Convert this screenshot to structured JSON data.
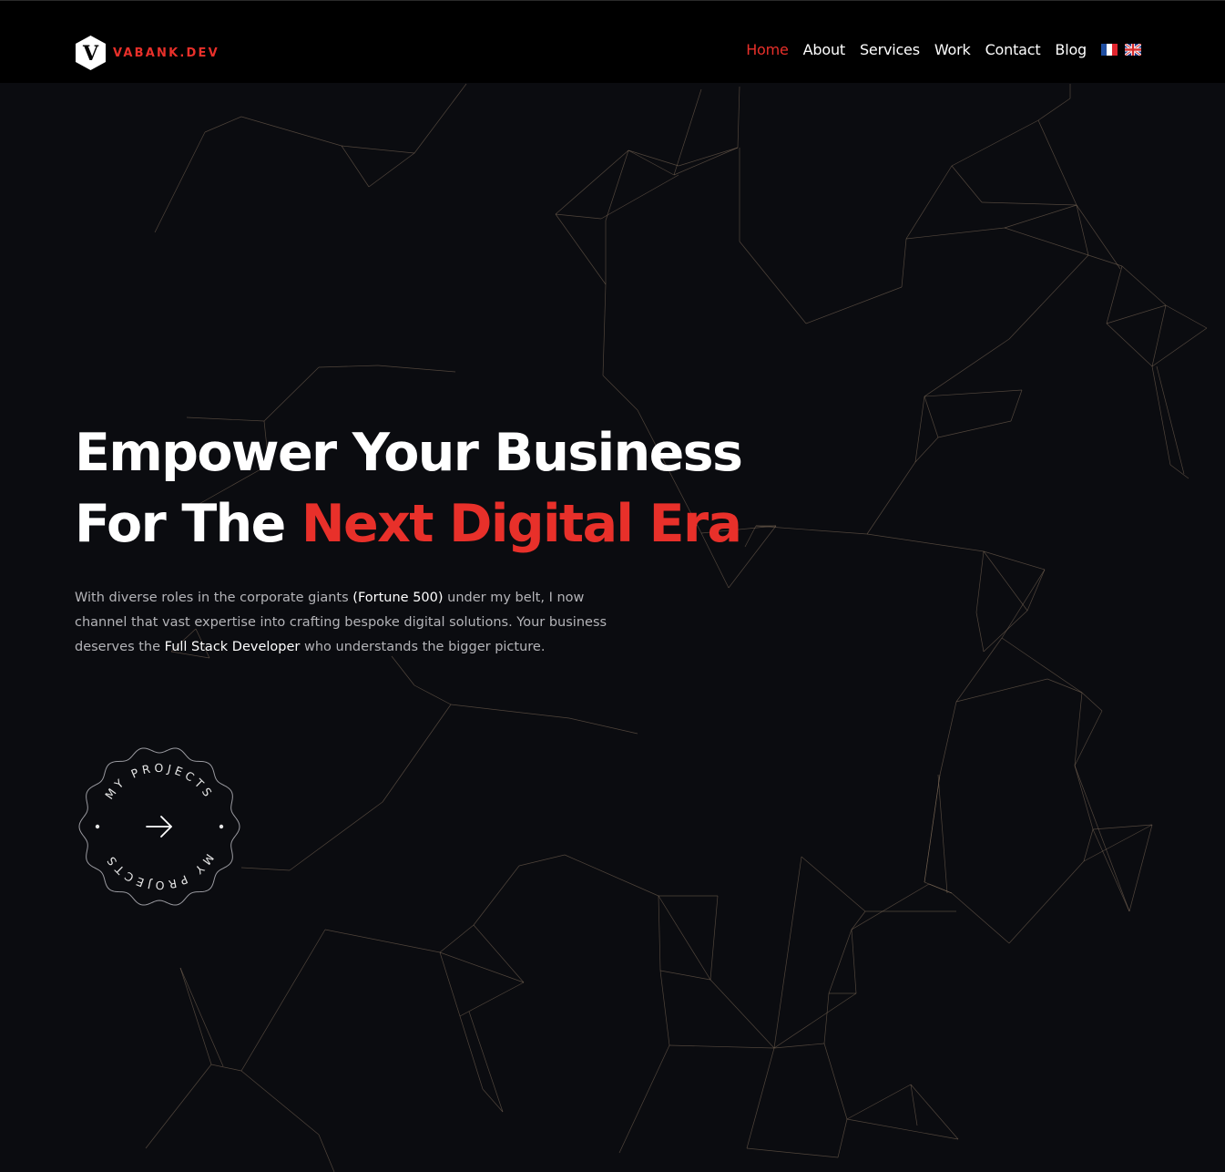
{
  "brand": {
    "logo_letter": "V",
    "name": "VABANK.DEV",
    "accent_color": "#e8302a"
  },
  "nav": {
    "items": [
      {
        "label": "Home",
        "active": true
      },
      {
        "label": "About",
        "active": false
      },
      {
        "label": "Services",
        "active": false
      },
      {
        "label": "Work",
        "active": false
      },
      {
        "label": "Contact",
        "active": false
      },
      {
        "label": "Blog",
        "active": false
      }
    ],
    "languages": [
      {
        "icon": "flag-fr-icon"
      },
      {
        "icon": "flag-uk-icon"
      }
    ]
  },
  "hero": {
    "title_line1": "Empower Your Business",
    "title_line2_prefix": "For The ",
    "title_line2_accent": "Next Digital Era",
    "text_part1": "With diverse roles in the corporate giants ",
    "text_highlight1": "(Fortune 500)",
    "text_part2": " under my belt, I now channel that vast expertise into crafting bespoke digital solutions. Your business deserves the ",
    "text_highlight2": "Full Stack Developer",
    "text_part3": " who understands the bigger picture."
  },
  "cta_badge": {
    "ring_text_top": "MY PROJECTS",
    "ring_text_bottom": "MY PROJECTS",
    "icon": "arrow-right-icon"
  },
  "colors": {
    "background": "#0b0c10",
    "header": "#000000",
    "network_lines": "#8a7560",
    "body_text": "#b4b4b8"
  }
}
